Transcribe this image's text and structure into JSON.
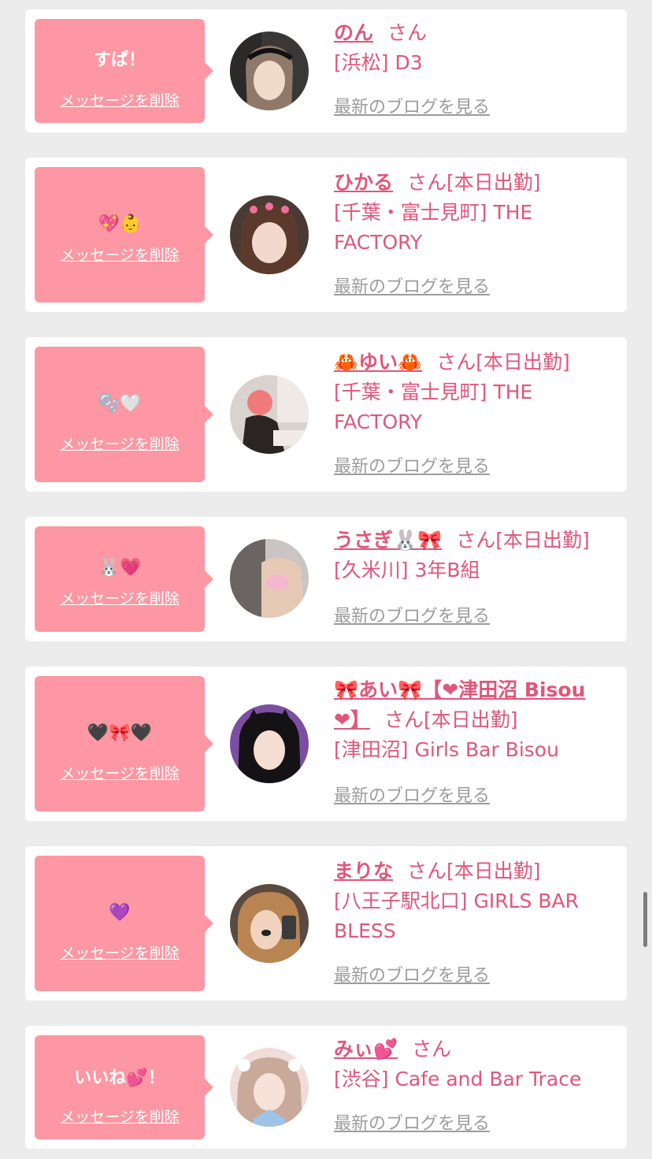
{
  "messages": [
    {
      "bubble_text": "すぱ！",
      "delete_label": "メッセージを削除",
      "name": "のん",
      "suffix": "さん",
      "name_line2": "",
      "shop": "[浜松] D3",
      "blog_link": "最新のブログを見る"
    },
    {
      "bubble_text": "💖👶",
      "delete_label": "メッセージを削除",
      "name": "ひかる",
      "suffix": "さん[本日出勤]",
      "name_line2": "",
      "shop": "[千葉・富士見町] THE FACTORY",
      "blog_link": "最新のブログを見る"
    },
    {
      "bubble_text": "🫧🤍",
      "delete_label": "メッセージを削除",
      "name": "🦀ゆい🦀",
      "suffix": "さん[本日出勤]",
      "name_line2": "",
      "shop": "[千葉・富士見町] THE FACTORY",
      "blog_link": "最新のブログを見る"
    },
    {
      "bubble_text": "🐰💗",
      "delete_label": "メッセージを削除",
      "name": "うさぎ🐰🎀",
      "suffix": "さん[本日出勤]",
      "name_line2": "",
      "shop": "[久米川] 3年B組",
      "blog_link": "最新のブログを見る"
    },
    {
      "bubble_text": "🖤🎀🖤",
      "delete_label": "メッセージを削除",
      "name": "🎀あい🎀【❤津田沼 Bisou",
      "suffix": "",
      "name_line2": "❤】",
      "suffix2": "さん[本日出勤]",
      "shop": "[津田沼] Girls Bar Bisou",
      "blog_link": "最新のブログを見る"
    },
    {
      "bubble_text": "💜",
      "delete_label": "メッセージを削除",
      "name": "まりな",
      "suffix": "さん[本日出勤]",
      "name_line2": "",
      "shop": "[八王子駅北口] GIRLS BAR BLESS",
      "blog_link": "最新のブログを見る"
    },
    {
      "bubble_text": "いいね💕！",
      "delete_label": "メッセージを削除",
      "name": "みぃ💕",
      "suffix": "さん",
      "name_line2": "",
      "shop": "[渋谷] Cafe and Bar Trace",
      "blog_link": "最新のブログを見る"
    }
  ],
  "colors": {
    "bubble": "#fd97a3",
    "name": "#e0567a",
    "link_gray": "#9c9c9c",
    "background": "#ececec"
  }
}
